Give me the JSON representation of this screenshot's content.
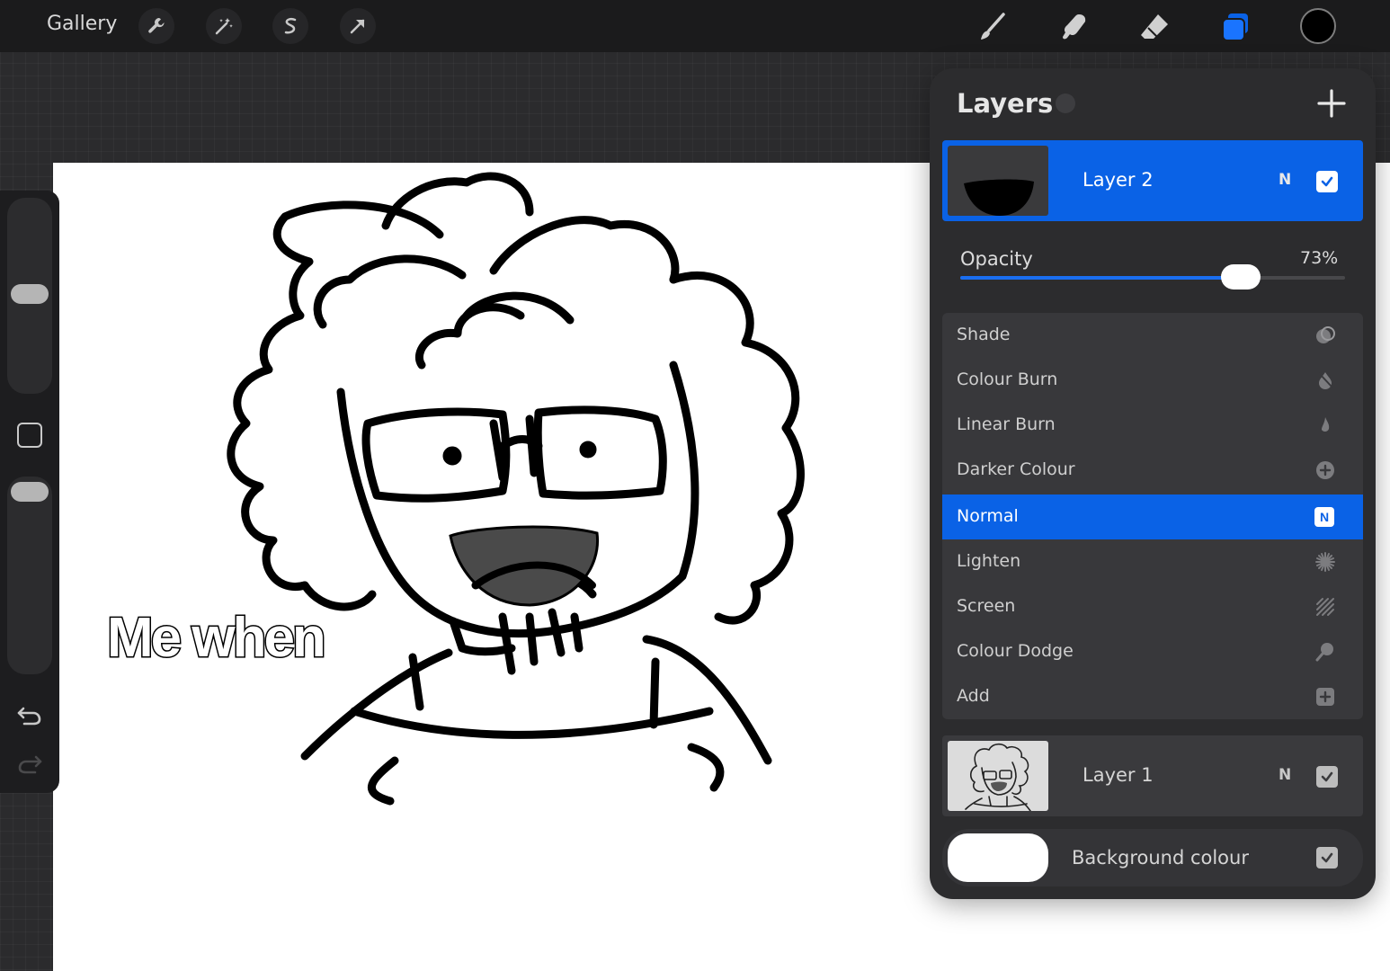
{
  "topbar": {
    "gallery_label": "Gallery",
    "left_tools": [
      "wrench-icon",
      "magic-wand-icon",
      "selection-icon",
      "transform-icon"
    ],
    "right_tools": [
      "brush-icon",
      "smudge-icon",
      "eraser-icon",
      "layers-icon"
    ],
    "current_color": "#000000",
    "accent_color": "#0a62e6"
  },
  "canvas": {
    "caption_text": "Me when"
  },
  "sidebar": {
    "tools": [
      "brush-size-slider",
      "modify-button",
      "brush-opacity-slider",
      "undo-icon",
      "redo-icon"
    ]
  },
  "layers_panel": {
    "title": "Layers",
    "layers": [
      {
        "name": "Layer 2",
        "mode": "N",
        "visible": true,
        "selected": true
      },
      {
        "name": "Layer 1",
        "mode": "N",
        "visible": true,
        "selected": false
      }
    ],
    "opacity": {
      "label": "Opacity",
      "value_text": "73%",
      "value": 0.73
    },
    "blend_modes": [
      {
        "label": "Shade",
        "icon": "shade-icon"
      },
      {
        "label": "Colour Burn",
        "icon": "colour-burn-icon"
      },
      {
        "label": "Linear Burn",
        "icon": "linear-burn-icon"
      },
      {
        "label": "Darker Colour",
        "icon": "darker-colour-icon"
      },
      {
        "label": "Normal",
        "icon": "normal-icon",
        "icon_text": "N",
        "selected": true
      },
      {
        "label": "Lighten",
        "icon": "lighten-icon"
      },
      {
        "label": "Screen",
        "icon": "screen-icon"
      },
      {
        "label": "Colour Dodge",
        "icon": "colour-dodge-icon"
      },
      {
        "label": "Add",
        "icon": "add-blend-icon"
      }
    ],
    "background": {
      "label": "Background colour",
      "color": "#ffffff",
      "visible": true
    }
  }
}
